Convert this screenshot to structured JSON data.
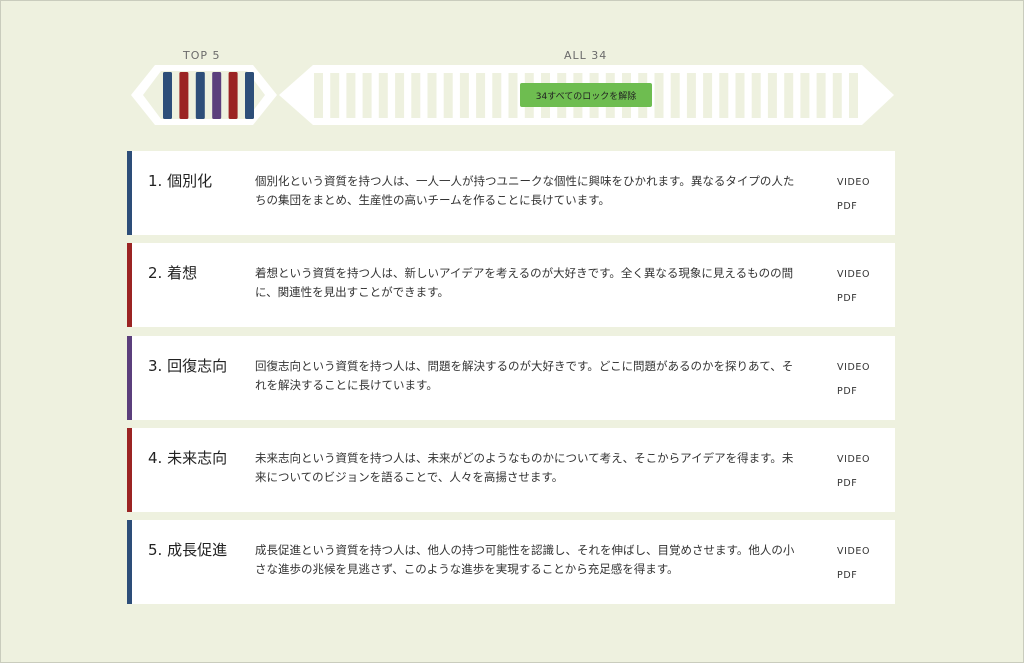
{
  "header": {
    "top_label": "TOP 5",
    "all_label": "ALL 34",
    "unlock_button": "34すべてのロックを解除"
  },
  "top5_bar_colors": [
    "#2d4e79",
    "#9b2423",
    "#2d4e79",
    "#5b3f7c",
    "#9b2423",
    "#2d4e79"
  ],
  "locked_bar_count": 34,
  "colors": {
    "background": "#eef1df",
    "locked_bar": "#eef1df",
    "unlock_button": "#6ebd50",
    "blue": "#2d4e79",
    "red": "#9b2423",
    "purple": "#5b3f7c"
  },
  "strengths": [
    {
      "title": "1. 個別化",
      "description": "個別化という資質を持つ人は、一人一人が持つユニークな個性に興味をひかれます。異なるタイプの人たちの集団をまとめ、生産性の高いチームを作ることに長けています。",
      "video_label": "VIDEO",
      "pdf_label": "PDF",
      "color": "#2d4e79"
    },
    {
      "title": "2. 着想",
      "description": "着想という資質を持つ人は、新しいアイデアを考えるのが大好きです。全く異なる現象に見えるものの間に、関連性を見出すことができます。",
      "video_label": "VIDEO",
      "pdf_label": "PDF",
      "color": "#9b2423"
    },
    {
      "title": "3. 回復志向",
      "description": "回復志向という資質を持つ人は、問題を解決するのが大好きです。どこに問題があるのかを探りあて、それを解決することに長けています。",
      "video_label": "VIDEO",
      "pdf_label": "PDF",
      "color": "#5b3f7c"
    },
    {
      "title": "4. 未来志向",
      "description": "未来志向という資質を持つ人は、未来がどのようなものかについて考え、そこからアイデアを得ます。未来についてのビジョンを語ることで、人々を高揚させます。",
      "video_label": "VIDEO",
      "pdf_label": "PDF",
      "color": "#9b2423"
    },
    {
      "title": "5. 成長促進",
      "description": "成長促進という資質を持つ人は、他人の持つ可能性を認識し、それを伸ばし、目覚めさせます。他人の小さな進歩の兆候を見逃さず、このような進歩を実現することから充足感を得ます。",
      "video_label": "VIDEO",
      "pdf_label": "PDF",
      "color": "#2d4e79"
    }
  ]
}
